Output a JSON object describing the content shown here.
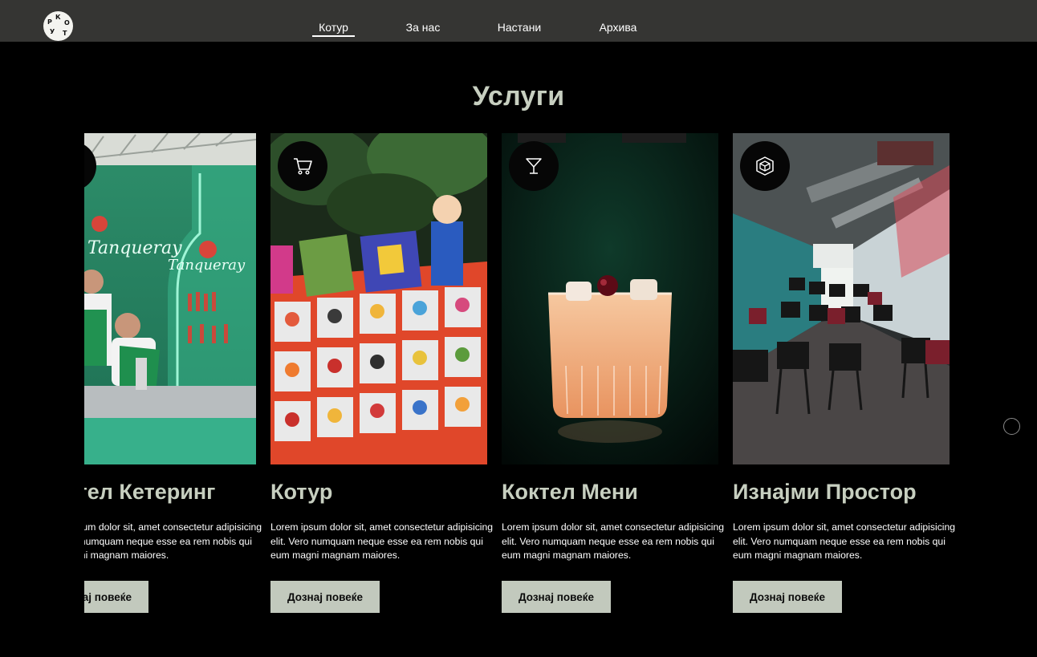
{
  "nav": {
    "items": [
      {
        "label": "Котур",
        "active": true
      },
      {
        "label": "За нас"
      },
      {
        "label": "Настани"
      },
      {
        "label": "Архива"
      }
    ],
    "logo_letters": [
      "К",
      "О",
      "Т",
      "У",
      "Р"
    ]
  },
  "section": {
    "title": "Услуги"
  },
  "cards": [
    {
      "title": "Коктел Кетеринг",
      "text": "Lorem ipsum dolor sit, amet consectetur adipisicing elit. Vero numquam neque esse ea rem nobis qui eum magni magnam maiores.",
      "button": "Дознај повеќе",
      "icon": "partial-badge"
    },
    {
      "title": "Котур",
      "text": "Lorem ipsum dolor sit, amet consectetur adipisicing elit. Vero numquam neque esse ea rem nobis qui eum magni magnam maiores.",
      "button": "Дознај повеќе",
      "icon": "cart-icon"
    },
    {
      "title": "Коктел Мени",
      "text": "Lorem ipsum dolor sit, amet consectetur adipisicing elit. Vero numquam neque esse ea rem nobis qui eum magni magnam maiores.",
      "button": "Дознај повеќе",
      "icon": "cocktail-icon"
    },
    {
      "title": "Изнајми Простор",
      "text": "Lorem ipsum dolor sit, amet consectetur adipisicing elit. Vero numquam neque esse ea rem nobis qui eum magni magnam maiores.",
      "button": "Дознај повеќе",
      "icon": "space-icon"
    }
  ],
  "colors": {
    "topbar": "#353533",
    "accent_text": "#c7cfc0",
    "button_bg": "#c2c9bd",
    "background": "#000000"
  }
}
